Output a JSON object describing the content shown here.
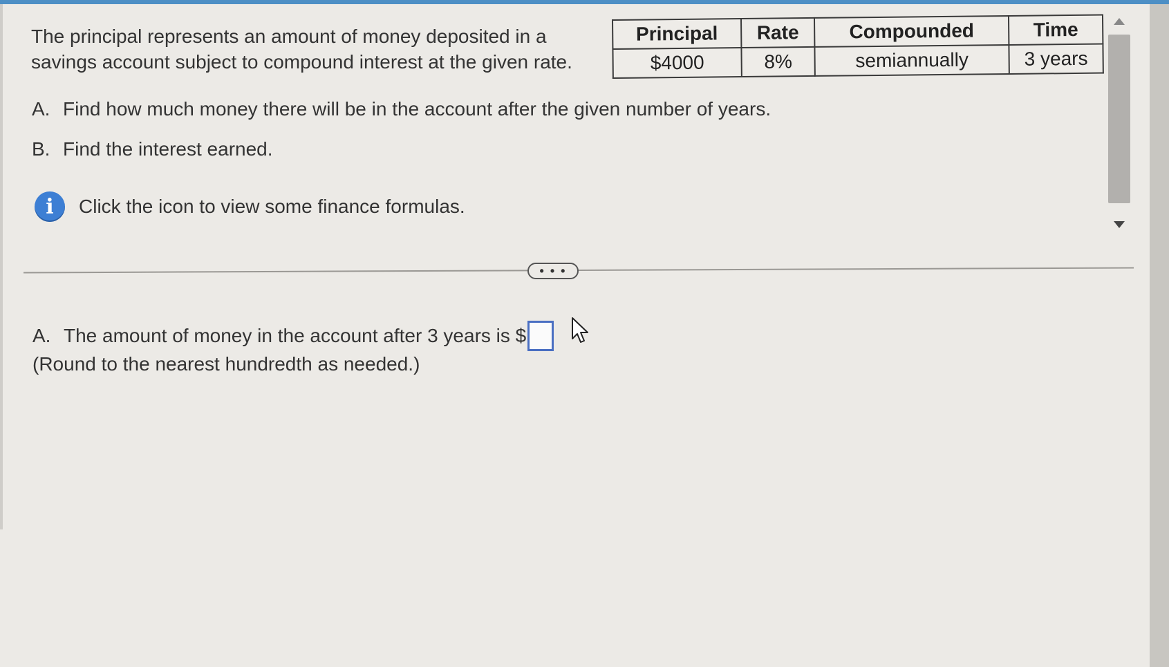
{
  "question": {
    "text_line1": "The principal represents an amount of money deposited in a",
    "text_line2": "savings account subject to compound interest at the given rate."
  },
  "table": {
    "headers": [
      "Principal",
      "Rate",
      "Compounded",
      "Time"
    ],
    "row": [
      "$4000",
      "8%",
      "semiannually",
      "3 years"
    ]
  },
  "tasks": [
    {
      "letter": "A.",
      "text": "Find how much money there will be in the account after the given number of years."
    },
    {
      "letter": "B.",
      "text": "Find the interest earned."
    }
  ],
  "info": {
    "icon": "info-icon",
    "icon_glyph": "i",
    "text": "Click the icon to view some finance formulas."
  },
  "divider": {
    "button_label": "• • •"
  },
  "answer": {
    "letter": "A.",
    "prompt": "The amount of money in the account after 3 years is $",
    "value": "",
    "note": "(Round to the nearest hundredth as needed.)"
  },
  "colors": {
    "accent": "#4d8fc5",
    "info_icon": "#3d7fd4",
    "input_border": "#4a6fc2"
  }
}
